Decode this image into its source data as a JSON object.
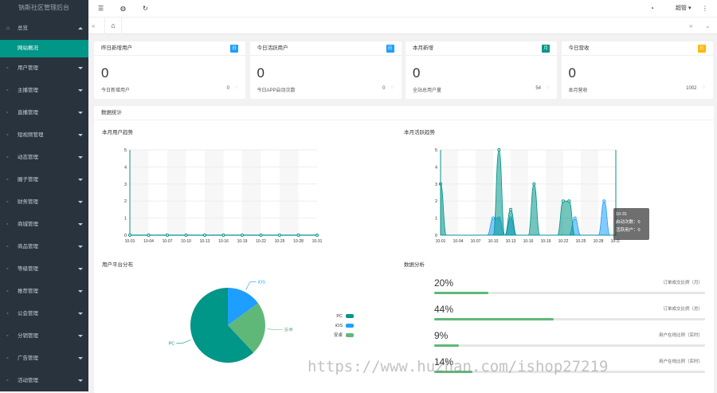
{
  "sidebar": {
    "brand": "钠斯社区管理后台",
    "home": "总览",
    "home_sub": "网站概况",
    "items": [
      {
        "label": "用户管理",
        "icon": "person-icon"
      },
      {
        "label": "主播管理",
        "icon": "shield-icon"
      },
      {
        "label": "直播管理",
        "icon": "video-icon"
      },
      {
        "label": "短视频管理",
        "icon": "play-icon"
      },
      {
        "label": "动态管理",
        "icon": "feed-icon"
      },
      {
        "label": "圈子管理",
        "icon": "group-icon"
      },
      {
        "label": "财务管理",
        "icon": "wallet-icon"
      },
      {
        "label": "商城管理",
        "icon": "cart-icon"
      },
      {
        "label": "商品管理",
        "icon": "goods-icon"
      },
      {
        "label": "等级管理",
        "icon": "level-icon"
      },
      {
        "label": "推荐管理",
        "icon": "star-icon"
      },
      {
        "label": "公会管理",
        "icon": "guild-icon"
      },
      {
        "label": "分销管理",
        "icon": "share-icon"
      },
      {
        "label": "广告管理",
        "icon": "ad-icon"
      },
      {
        "label": "活动管理",
        "icon": "event-icon"
      }
    ]
  },
  "topbar": {
    "user": "超管"
  },
  "stats": [
    {
      "title": "昨日新增用户",
      "badge": "日",
      "badge_color": "#1e9fff",
      "value": "0",
      "foot": "今日新增用户",
      "foot_value": "0"
    },
    {
      "title": "今日活跃用户",
      "badge": "日",
      "badge_color": "#1e9fff",
      "value": "0",
      "foot": "今日APP启动次数",
      "foot_value": "0"
    },
    {
      "title": "本月新增",
      "badge": "月",
      "badge_color": "#009688",
      "value": "0",
      "foot": "全站总用户量",
      "foot_value": "54"
    },
    {
      "title": "今日营收",
      "badge": "日",
      "badge_color": "#ffb800",
      "value": "0",
      "foot": "本月营收",
      "foot_value": "1002"
    }
  ],
  "panel": {
    "title": "数据统计",
    "chart1_title": "本月用户趋势",
    "chart2_title": "本月活跃趋势",
    "pie_title": "用户平台分布",
    "analysis_title": "数据分析",
    "tooltip": {
      "date": "10-31",
      "line1": "启动次数：0",
      "line2": "活跃用户：0"
    }
  },
  "progress": [
    {
      "pct": "20%",
      "value": 0.2,
      "label": "订单成交比例（月）"
    },
    {
      "pct": "44%",
      "value": 0.44,
      "label": "订单成交比例（总）"
    },
    {
      "pct": "9%",
      "value": 0.09,
      "label": "用户在线比例（实时）"
    },
    {
      "pct": "14%",
      "value": 0.14,
      "label": "用户在线比例（实时）"
    }
  ],
  "watermark": "https://www.huzhan.com/ishop27219",
  "chart_data": [
    {
      "type": "line",
      "title": "本月用户趋势",
      "x": [
        "10-01",
        "10-04",
        "10-07",
        "10-10",
        "10-13",
        "10-16",
        "10-19",
        "10-22",
        "10-25",
        "10-28",
        "10-31"
      ],
      "ylim": [
        0,
        5
      ],
      "yticks": [
        0,
        1,
        2,
        3,
        4,
        5
      ],
      "series": [
        {
          "values": [
            0,
            0,
            0,
            0,
            0,
            0,
            0,
            0,
            0,
            0,
            0
          ],
          "color": "#009688"
        }
      ]
    },
    {
      "type": "area",
      "title": "本月活跃趋势",
      "x": [
        "10-01",
        "10-04",
        "10-07",
        "10-10",
        "10-13",
        "10-16",
        "10-19",
        "10-22",
        "10-25",
        "10-28",
        "10-31"
      ],
      "ylim": [
        0,
        5
      ],
      "yticks": [
        0,
        1,
        2,
        3,
        4,
        5
      ],
      "series": [
        {
          "values": [
            3,
            0,
            0,
            0,
            0,
            0,
            0,
            0,
            0,
            0,
            5,
            0,
            1.5,
            0,
            0,
            0,
            3,
            0,
            0,
            0,
            0,
            2,
            2,
            0,
            0,
            0,
            0,
            0,
            0,
            0,
            0
          ],
          "color": "#009688"
        },
        {
          "values": [
            0,
            0,
            0,
            0,
            0,
            0,
            0,
            0,
            0,
            1,
            1,
            0,
            1,
            0,
            0,
            0,
            0,
            0,
            0,
            0,
            0,
            0,
            0,
            1,
            0,
            0,
            0,
            0,
            2,
            0,
            0
          ],
          "color": "#1e9fff"
        }
      ]
    },
    {
      "type": "pie",
      "title": "用户平台分布",
      "labels": [
        "PC",
        "iOS",
        "安卓"
      ],
      "values": [
        62,
        15,
        23
      ],
      "colors": [
        "#009688",
        "#1e9fff",
        "#5fb878"
      ]
    }
  ]
}
